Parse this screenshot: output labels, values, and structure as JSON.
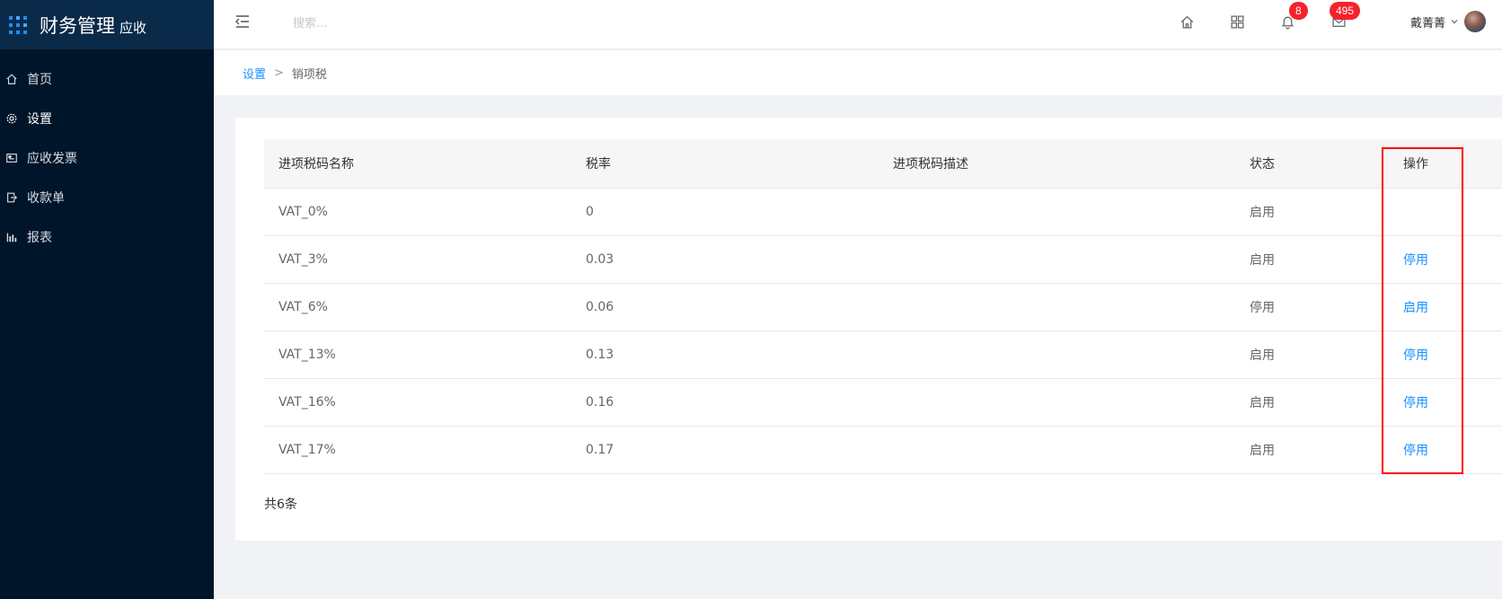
{
  "app": {
    "title": "财务管理",
    "subtitle": "应收"
  },
  "sidebar": {
    "items": [
      {
        "label": "首页",
        "icon": "home-icon"
      },
      {
        "label": "设置",
        "icon": "gear-icon",
        "active": true
      },
      {
        "label": "应收发票",
        "icon": "invoice-icon"
      },
      {
        "label": "收款单",
        "icon": "receipt-icon"
      },
      {
        "label": "报表",
        "icon": "bar-chart-icon"
      }
    ]
  },
  "header": {
    "search_placeholder": "搜索...",
    "notification_count": "8",
    "message_count": "495",
    "user_name": "戴菁菁"
  },
  "breadcrumb": {
    "parent": "设置",
    "separator": ">",
    "current": "销项税"
  },
  "table": {
    "columns": [
      "进项税码名称",
      "税率",
      "进项税码描述",
      "状态",
      "操作"
    ],
    "rows": [
      {
        "name": "VAT_0%",
        "rate": "0",
        "desc": "",
        "status": "启用",
        "action": ""
      },
      {
        "name": "VAT_3%",
        "rate": "0.03",
        "desc": "",
        "status": "启用",
        "action": "停用"
      },
      {
        "name": "VAT_6%",
        "rate": "0.06",
        "desc": "",
        "status": "停用",
        "action": "启用"
      },
      {
        "name": "VAT_13%",
        "rate": "0.13",
        "desc": "",
        "status": "启用",
        "action": "停用"
      },
      {
        "name": "VAT_16%",
        "rate": "0.16",
        "desc": "",
        "status": "启用",
        "action": "停用"
      },
      {
        "name": "VAT_17%",
        "rate": "0.17",
        "desc": "",
        "status": "启用",
        "action": "停用"
      }
    ],
    "total": "共6条"
  },
  "colors": {
    "sidebar_bg": "#001529",
    "accent": "#1890ff",
    "badge": "#f5222d",
    "highlight": "#ff0000"
  }
}
